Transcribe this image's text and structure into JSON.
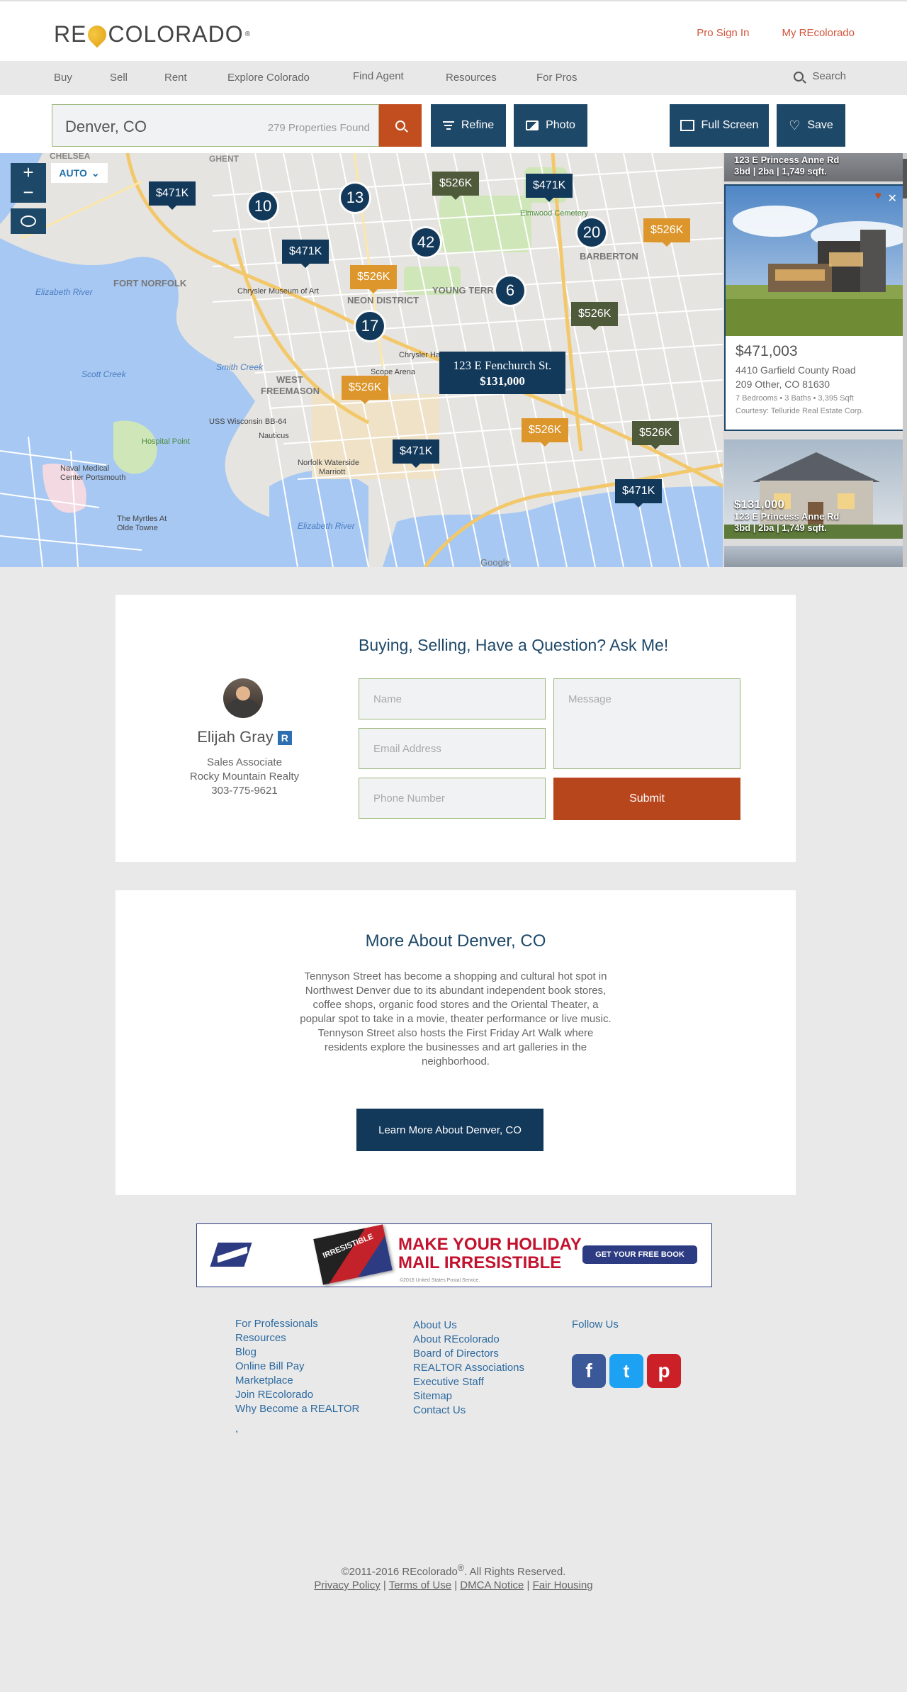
{
  "header": {
    "logo_left": "RE",
    "logo_right": "COLORADO",
    "logo_reg": "®",
    "pro_sign_in": "Pro Sign In",
    "my_recolorado": "My REcolorado"
  },
  "nav": {
    "items": [
      "Buy",
      "Sell",
      "Rent",
      "Explore Colorado",
      "Find Agent",
      "Resources",
      "For Pros"
    ],
    "search_label": "Search"
  },
  "search": {
    "location": "Denver, CO",
    "count": "279 Properties Found",
    "refine": "Refine",
    "photo": "Photo",
    "full_screen": "Full Screen",
    "save": "Save"
  },
  "map": {
    "auto_label": "AUTO",
    "zoom_in": "+",
    "zoom_out": "−",
    "markers": [
      {
        "label": "$471K",
        "color": "blue"
      },
      {
        "label": "$526K",
        "color": "olive"
      },
      {
        "label": "$471K",
        "color": "blue"
      },
      {
        "label": "$526K",
        "color": "orange"
      },
      {
        "label": "$471K",
        "color": "blue"
      },
      {
        "label": "$526K",
        "color": "orange"
      },
      {
        "label": "$526K",
        "color": "olive"
      },
      {
        "label": "$526K",
        "color": "orange"
      },
      {
        "label": "$471K",
        "color": "blue"
      },
      {
        "label": "$526K",
        "color": "orange"
      },
      {
        "label": "$526K",
        "color": "olive"
      },
      {
        "label": "$471K",
        "color": "blue"
      }
    ],
    "clusters": [
      "10",
      "13",
      "42",
      "20",
      "6",
      "17"
    ],
    "popup": {
      "address": "123 E Fenchurch St.",
      "price": "$131,000"
    },
    "place_labels": [
      "CHELSEA",
      "GHENT",
      "FORT NORFOLK",
      "NEON DISTRICT",
      "YOUNG TERRACE",
      "BARBERTON",
      "WEST FREEMASON",
      "Scott Creek",
      "Smith Creek",
      "Elizabeth River",
      "Naval Medical Center Portsmouth",
      "Hospital Point",
      "The Myrtles At Olde Towne",
      "Chrysler Museum of Art",
      "Scope Arena",
      "Norfolk Waterside Marriott",
      "Nauticus",
      "USS Wisconsin BB-64",
      "Elmwood Cemetery",
      "Chrysler Hall",
      "Google"
    ]
  },
  "listings": {
    "top_card": {
      "address": "123 E Princess Anne Rd",
      "specs": "3bd | 2ba | 1,749 sqft."
    },
    "featured": {
      "price": "$471,003",
      "address": "4410 Garfield County Road",
      "city": "209 Other, CO 81630",
      "specs": "7 Bedrooms • 3 Baths • 3,395 Sqft",
      "courtesy": "Courtesy: Telluride Real Estate Corp."
    },
    "second_card": {
      "price": "$131,000",
      "address": "123 E Princess Anne Rd",
      "specs": "3bd | 2ba | 1,749 sqft."
    }
  },
  "contact": {
    "title": "Buying, Selling, Have a Question? Ask Me!",
    "agent_name": "Elijah Gray",
    "agent_badge": "R",
    "agent_role": "Sales Associate",
    "agent_company": "Rocky Mountain Realty",
    "agent_phone": "303-775-9621",
    "name_placeholder": "Name",
    "email_placeholder": "Email Address",
    "phone_placeholder": "Phone Number",
    "message_placeholder": "Message",
    "submit": "Submit"
  },
  "more": {
    "title": "More About Denver, CO",
    "text": "Tennyson Street has become a shopping and cultural hot spot in Northwest Denver due to its abundant independent book stores, coffee shops, organic food stores and the Oriental Theater, a popular spot to take in a movie, theater performance or live music. Tennyson Street also hosts the First Friday Art Walk where residents explore the businesses and art galleries in the neighborhood.",
    "button": "Learn More About Denver, CO"
  },
  "ad": {
    "headline_1": "MAKE YOUR HOLIDAY",
    "headline_2": "MAIL IRRESISTIBLE",
    "cta": "GET YOUR FREE BOOK",
    "stamp_text": "IRRESISTIBLE",
    "legal": "©2016 United States Postal Service."
  },
  "footer": {
    "col1": [
      "For Professionals",
      "Resources",
      "Blog",
      "Online Bill Pay",
      "Marketplace",
      "Join REcolorado",
      "Why Become a REALTOR"
    ],
    "col1_extra": ",",
    "col2": [
      "About Us",
      "About REcolorado",
      "Board of Directors",
      "REALTOR Associations",
      "Executive Staff",
      "Sitemap",
      "Contact Us"
    ],
    "follow": "Follow Us",
    "social": [
      "f",
      "t",
      "p"
    ],
    "copyright": "©2011-2016 REcolorado",
    "copyright_reg": "®",
    "copyright_tail": ". All Rights Reserved.",
    "legal": [
      "Privacy Policy",
      "Terms of Use",
      "DMCA Notice",
      "Fair Housing"
    ]
  },
  "colors": {
    "navy": "#1e4868",
    "accent": "#c24e20",
    "orange_marker": "#dc962b",
    "olive_marker": "#4f5a3b",
    "facebook": "#3b5998",
    "twitter": "#1da1f2",
    "pinterest": "#cb2027"
  }
}
